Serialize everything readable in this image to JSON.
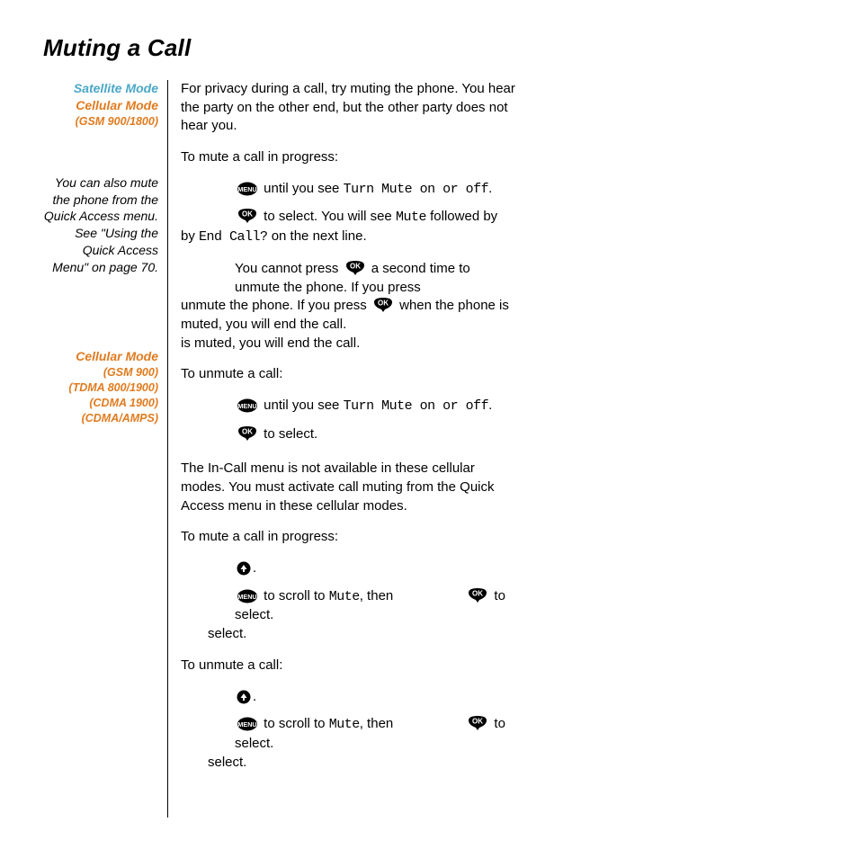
{
  "title": "Muting a Call",
  "sidebar": {
    "satellite_mode": "Satellite Mode",
    "cellular_mode": "Cellular Mode",
    "gsm_900_1800": "(GSM 900/1800)",
    "note": "You can also mute the phone from the Quick Access menu. See \"Using the Quick Access Menu\" on page 70.",
    "cellular_mode2": "Cellular Mode",
    "gsm_900": "(GSM 900)",
    "tdma": "(TDMA 800/1900)",
    "cdma1900": "(CDMA 1900)",
    "cdma_amps": "(CDMA/AMPS)"
  },
  "main": {
    "intro": "For privacy during a call, try muting the phone. You hear the party on the other end, but the other party does not hear you.",
    "to_mute": "To mute a call in progress:",
    "step1_a": " until you see ",
    "turn_mute": "Turn Mute on or off",
    "period": ".",
    "step2_a": " to select. You will see ",
    "mute_word": "Mute",
    "step2_b": " followed by ",
    "end_call": "End Call?",
    "step2_c": " on the next line.",
    "note_a": "You cannot press ",
    "note_b": " a second time to unmute the phone. If you press ",
    "note_c": " when the phone is muted, you will end the call.",
    "to_unmute": "To unmute a call:",
    "unmute1": " until you see ",
    "unmute2": " to select.",
    "section2_intro": "The In-Call menu is not available in these cellular modes. You must activate call muting from the Quick Access menu in these cellular modes.",
    "to_mute2": "To mute a call in progress:",
    "scroll_a": " to scroll to ",
    "scroll_b": ", then",
    "scroll_c": " to select.",
    "to_unmute2": "To unmute a call:"
  }
}
